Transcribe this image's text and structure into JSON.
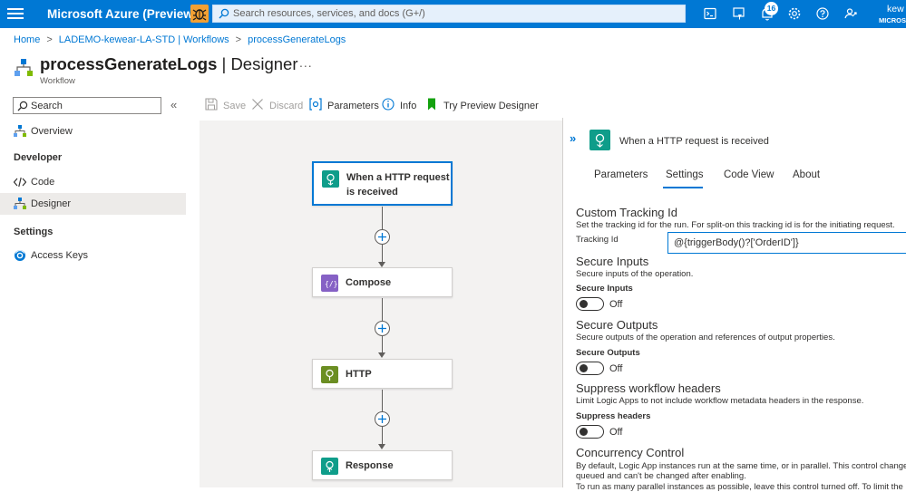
{
  "topbar": {
    "menu_icon": "hamburger-menu-icon",
    "brand": "Microsoft Azure (Preview)",
    "bug_icon": "bug-icon",
    "search_placeholder": "Search resources, services, and docs (G+/)",
    "icons": [
      "cloud-shell-icon",
      "directory-filter-icon",
      "notifications-icon",
      "settings-gear-icon",
      "help-icon",
      "feedback-icon"
    ],
    "notifications_count": "16",
    "user_name": "kew",
    "user_tenant": "MICROSO"
  },
  "breadcrumb": [
    "Home",
    "LADEMO-kewear-LA-STD | Workflows",
    "processGenerateLogs"
  ],
  "page": {
    "title_main": "processGenerateLogs",
    "title_suffix": " | Designer",
    "more": "...",
    "subtitle": "Workflow"
  },
  "nav": {
    "search_placeholder": "Search",
    "collapse": "«",
    "items": [
      {
        "label": "Overview",
        "icon": "workflow-overview-icon"
      },
      {
        "label": "Code",
        "icon": "code-icon"
      },
      {
        "label": "Designer",
        "icon": "designer-icon"
      },
      {
        "label": "Access Keys",
        "icon": "access-keys-icon"
      }
    ],
    "headings": [
      "Developer",
      "Settings"
    ]
  },
  "commandbar": {
    "save": "Save",
    "discard": "Discard",
    "parameters": "Parameters",
    "info": "Info",
    "preview": "Try Preview Designer"
  },
  "workflow": {
    "trigger": "When a HTTP request is received",
    "steps": [
      {
        "label": "Compose",
        "icon": "compose-icon",
        "color": "#8661c5"
      },
      {
        "label": "HTTP",
        "icon": "http-icon",
        "color": "#6b8e23"
      },
      {
        "label": "Response",
        "icon": "response-icon",
        "color": "#0f9d8a"
      }
    ],
    "trigger_color": "#0f9d8a"
  },
  "panel": {
    "expand": "»",
    "title": "When a HTTP request is received",
    "tabs": [
      "Parameters",
      "Settings",
      "Code View",
      "About"
    ],
    "active_tab": "Settings",
    "tracking": {
      "title": "Custom Tracking Id",
      "desc": "Set the tracking id for the run. For split-on this tracking id is for the initiating request.",
      "label": "Tracking Id",
      "value": "@{triggerBody()?['OrderID']}"
    },
    "secure_inputs": {
      "title": "Secure Inputs",
      "desc": "Secure inputs of the operation.",
      "label": "Secure Inputs",
      "state": "Off"
    },
    "secure_outputs": {
      "title": "Secure Outputs",
      "desc": "Secure outputs of the operation and references of output properties.",
      "label": "Secure Outputs",
      "state": "Off"
    },
    "suppress": {
      "title": "Suppress workflow headers",
      "desc": "Limit Logic Apps to not include workflow metadata headers in the response.",
      "label": "Suppress headers",
      "state": "Off"
    },
    "concurrency": {
      "title": "Concurrency Control",
      "desc1": "By default, Logic App instances run at the same time, or in parallel. This control changes h",
      "desc2": "queued and can't be changed after enabling.",
      "desc3": "To run as many parallel instances as possible, leave this control turned off. To limit the nu"
    }
  },
  "colors": {
    "azure_blue": "#0078d4",
    "canvas_bg": "#f3f2f1",
    "active_nav_bg": "#edebe9"
  }
}
